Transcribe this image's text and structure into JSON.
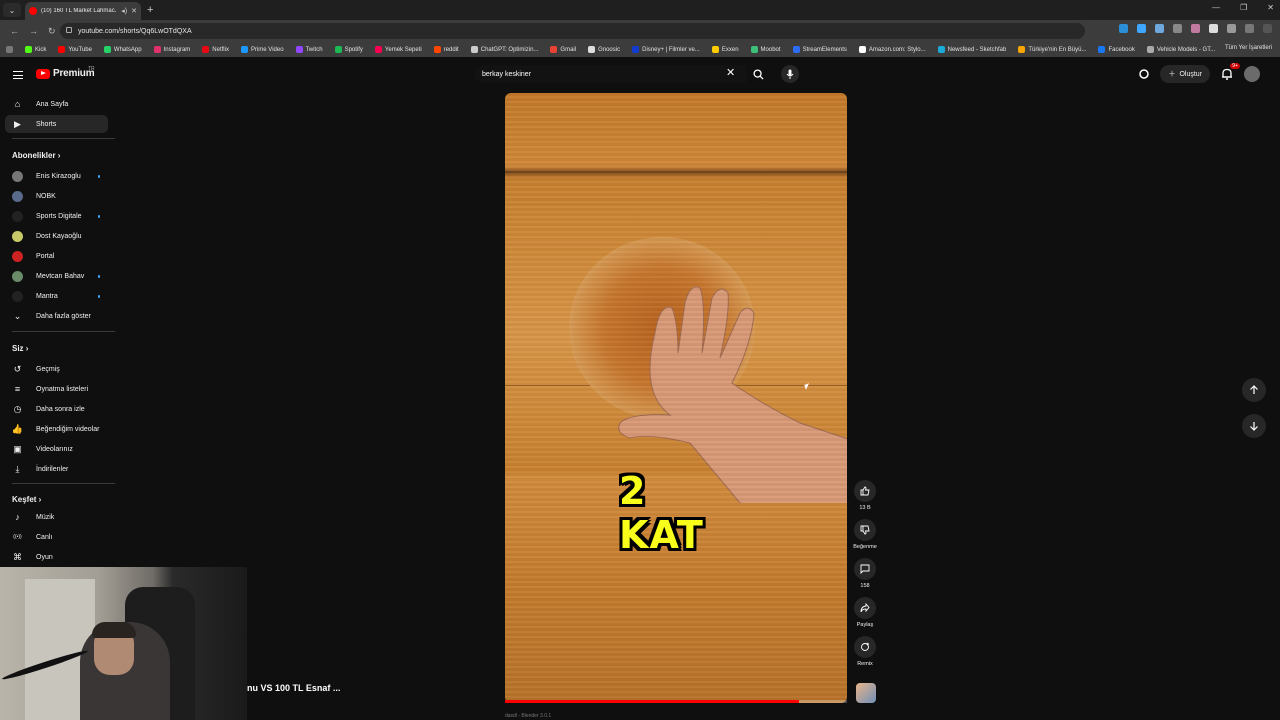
{
  "browser": {
    "tab_title": "(10) 160 TL Market Lahmac...",
    "url": "youtube.com/shorts/Qq6LwOTdQXA",
    "bookmarks": [
      {
        "label": "Kick",
        "color": "#53fc18"
      },
      {
        "label": "YouTube",
        "color": "#ff0000"
      },
      {
        "label": "WhatsApp",
        "color": "#25d366"
      },
      {
        "label": "Instagram",
        "color": "#e1306c"
      },
      {
        "label": "Netflix",
        "color": "#e50914"
      },
      {
        "label": "Prime Video",
        "color": "#1a98ff"
      },
      {
        "label": "Twitch",
        "color": "#9146ff"
      },
      {
        "label": "Spotify",
        "color": "#1db954"
      },
      {
        "label": "Yemek Sepeti",
        "color": "#fa0050"
      },
      {
        "label": "reddit",
        "color": "#ff4500"
      },
      {
        "label": "ChatGPT: Optimizin...",
        "color": "#cccccc"
      },
      {
        "label": "Gmail",
        "color": "#ea4335"
      },
      {
        "label": "Gnoosic",
        "color": "#dddddd"
      },
      {
        "label": "Disney+ | Filmler ve...",
        "color": "#113ccf"
      },
      {
        "label": "Exxen",
        "color": "#ffcc00"
      },
      {
        "label": "Moobot",
        "color": "#3dbf7a"
      },
      {
        "label": "StreamElements",
        "color": "#2f6cf5"
      },
      {
        "label": "Amazon.com: Stylo...",
        "color": "#ffffff"
      },
      {
        "label": "Newsfeed - Sketchfab",
        "color": "#1caad9"
      },
      {
        "label": "Türkiye'nin En Büyü...",
        "color": "#f7a600"
      },
      {
        "label": "Facebook",
        "color": "#1877f2"
      },
      {
        "label": "Vehicle Models - GT...",
        "color": "#aaaaaa"
      }
    ],
    "all_bookmarks": "Tüm Yer İşaretleri"
  },
  "header": {
    "logo_word": "Premium",
    "logo_region": "TR",
    "search_value": "berkay keskiner",
    "create_label": "Oluştur",
    "notif_badge": "9+"
  },
  "sidebar": {
    "main": [
      {
        "label": "Ana Sayfa",
        "icon": "home-icon"
      },
      {
        "label": "Shorts",
        "icon": "shorts-icon"
      }
    ],
    "subs_header": "Abonelikler",
    "subs": [
      {
        "label": "Enis Kirazoglu",
        "color": "#777777",
        "dot": true
      },
      {
        "label": "NOBK",
        "color": "#5a6a8a",
        "dot": false
      },
      {
        "label": "Sports Digitale",
        "color": "#222222",
        "dot": true
      },
      {
        "label": "Dost Kayaoğlu",
        "color": "#c9c96a",
        "dot": false
      },
      {
        "label": "Portal",
        "color": "#cc2222",
        "dot": false
      },
      {
        "label": "Mevtcan Bahav",
        "color": "#6a8a6a",
        "dot": true
      },
      {
        "label": "Mantra",
        "color": "#222222",
        "dot": true
      }
    ],
    "show_more": "Daha fazla göster",
    "you_header": "Siz",
    "you": [
      {
        "label": "Geçmiş",
        "icon": "history-icon"
      },
      {
        "label": "Oynatma listeleri",
        "icon": "playlist-icon"
      },
      {
        "label": "Daha sonra izle",
        "icon": "clock-icon"
      },
      {
        "label": "Beğendiğim videolar",
        "icon": "like-icon"
      },
      {
        "label": "Videolarınız",
        "icon": "video-icon"
      },
      {
        "label": "İndirilenler",
        "icon": "download-icon"
      }
    ],
    "explore_header": "Keşfet",
    "explore": [
      {
        "label": "Müzik",
        "icon": "music-icon"
      },
      {
        "label": "Canlı",
        "icon": "live-icon"
      },
      {
        "label": "Oyun",
        "icon": "game-icon"
      }
    ]
  },
  "video": {
    "overlay_text": "2 KAT",
    "overlay_color": "#f7ff1a",
    "progress": 0.86,
    "title_fragment": "nu VS 100 TL Esnaf ...",
    "subline": "dasdl - Blender 3.0.1"
  },
  "actions": {
    "like_count": "13 B",
    "dislike_label": "Beğenme",
    "comment_count": "158",
    "share_label": "Paylaş",
    "remix_label": "Remix"
  }
}
